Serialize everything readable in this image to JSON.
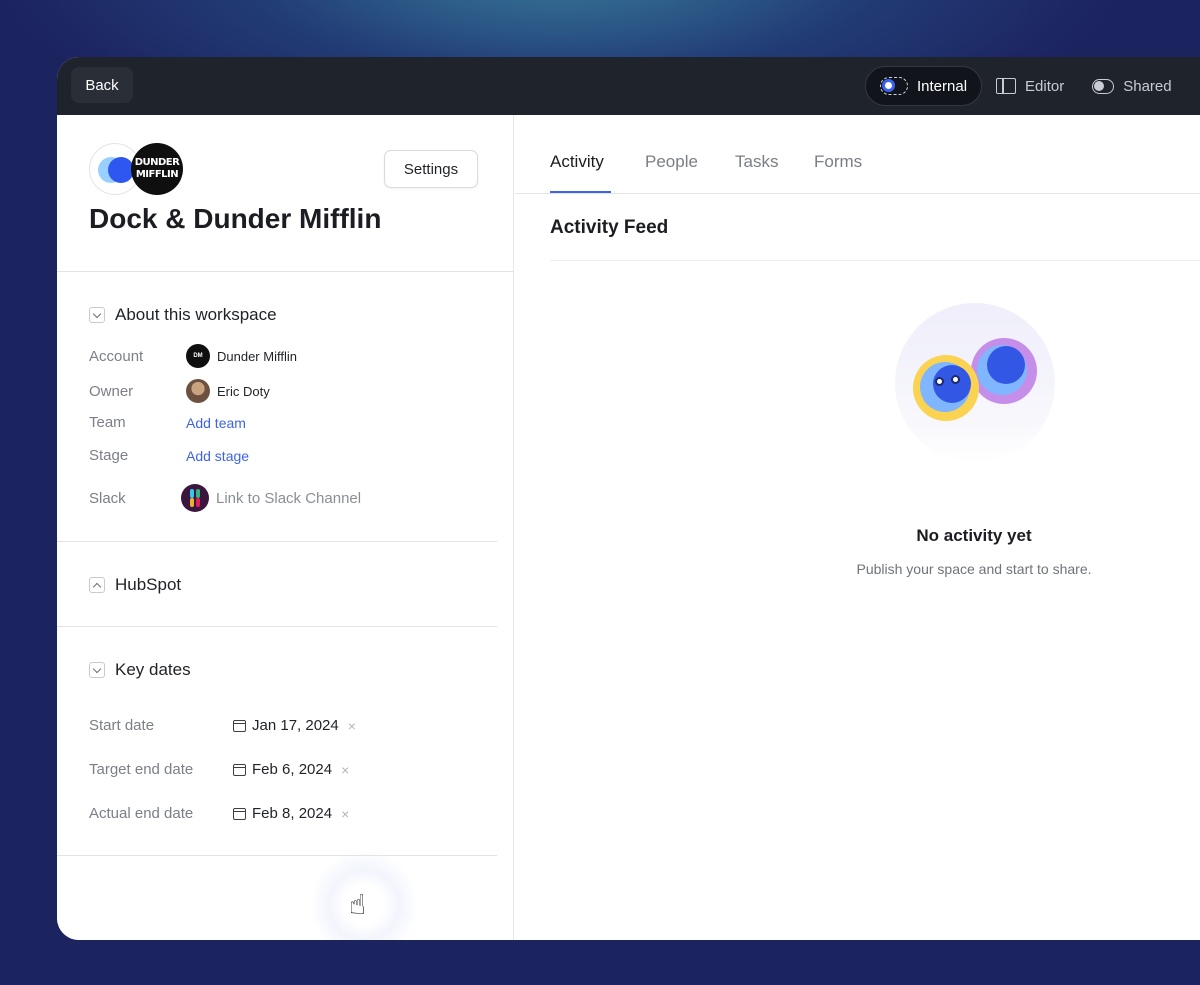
{
  "topbar": {
    "back_label": "Back",
    "modes": [
      {
        "label": "Internal",
        "icon": "internal-toggle-icon",
        "active": true
      },
      {
        "label": "Editor",
        "icon": "editor-panel-icon",
        "active": false
      },
      {
        "label": "Shared",
        "icon": "shared-toggle-icon",
        "active": false
      }
    ]
  },
  "workspace": {
    "title": "Dock & Dunder Mifflin",
    "settings_label": "Settings",
    "logo_text": [
      "DUNDER",
      "MIFFLIN"
    ]
  },
  "about": {
    "title": "About this workspace",
    "account_label": "Account",
    "account_value": "Dunder Mifflin",
    "owner_label": "Owner",
    "owner_value": "Eric Doty",
    "team_label": "Team",
    "team_value": "Add team",
    "stage_label": "Stage",
    "stage_value": "Add stage",
    "slack_label": "Slack",
    "slack_value": "Link to Slack Channel"
  },
  "hubspot": {
    "title": "HubSpot"
  },
  "key_dates": {
    "title": "Key dates",
    "start_label": "Start date",
    "start_value": "Jan 17, 2024",
    "target_label": "Target end date",
    "target_value": "Feb 6, 2024",
    "actual_label": "Actual end date",
    "actual_value": "Feb 8, 2024",
    "clear_symbol": "×"
  },
  "tabs": [
    "Activity",
    "People",
    "Tasks",
    "Forms"
  ],
  "feed": {
    "title": "Activity Feed",
    "empty_title": "No activity yet",
    "empty_subtitle": "Publish your space and start to share."
  },
  "colors": {
    "accent": "#3e63e6",
    "topbar": "#1f232b",
    "backdrop": "#1c2360"
  }
}
